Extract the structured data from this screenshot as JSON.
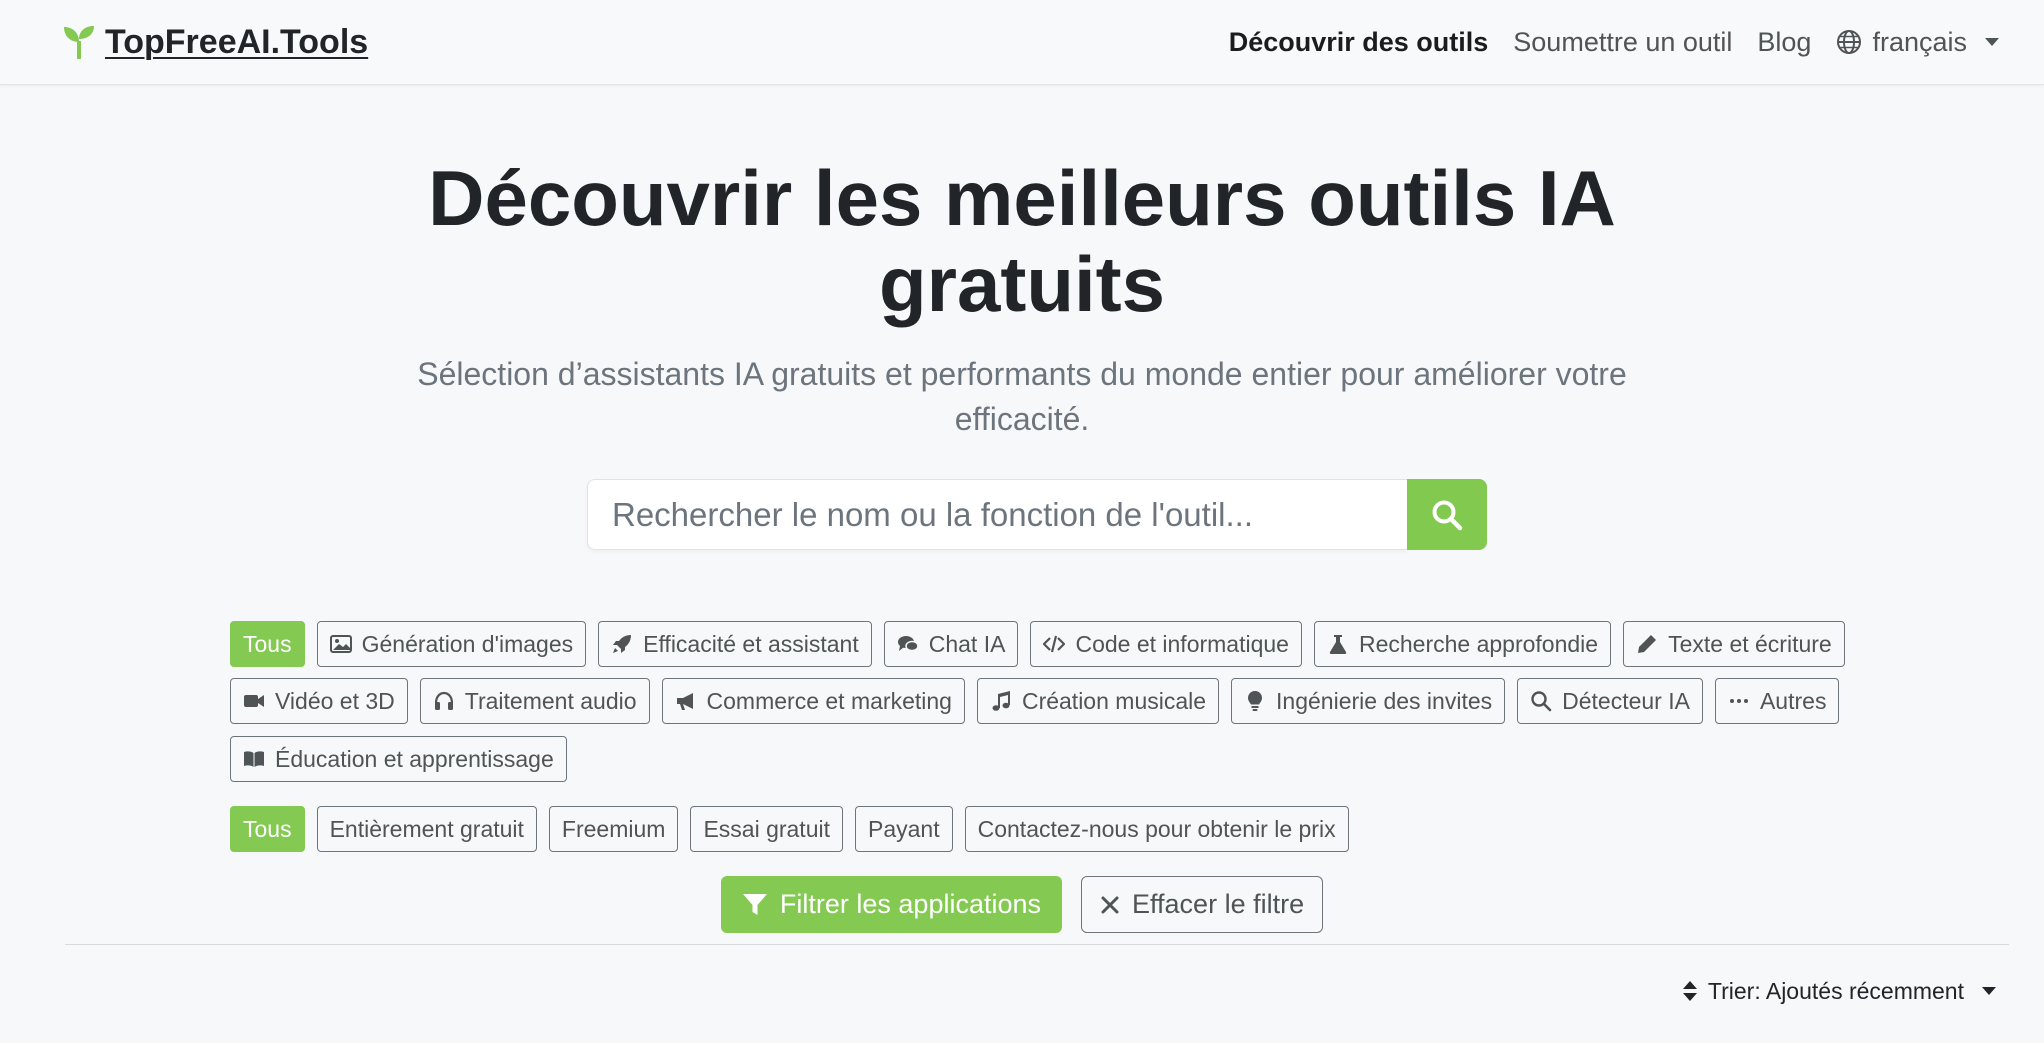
{
  "brand": {
    "name": "TopFreeAI.Tools",
    "accent": "#84c951"
  },
  "nav": {
    "items": [
      {
        "label": "Découvrir des outils",
        "active": true
      },
      {
        "label": "Soumettre un outil",
        "active": false
      },
      {
        "label": "Blog",
        "active": false
      }
    ],
    "language": {
      "label": "français",
      "icon": "globe-icon"
    }
  },
  "hero": {
    "title_line1": "Découvrir les meilleurs outils IA",
    "title_line2": "gratuits",
    "subtitle_line1": "Sélection d’assistants IA gratuits et performants du monde entier pour améliorer votre",
    "subtitle_line2": "efficacité."
  },
  "search": {
    "placeholder": "Rechercher le nom ou la fonction de l'outil...",
    "value": ""
  },
  "categories": [
    {
      "label": "Tous",
      "active": true,
      "icon": ""
    },
    {
      "label": "Génération d'images",
      "icon": "image-icon"
    },
    {
      "label": "Efficacité et assistant",
      "icon": "rocket-icon"
    },
    {
      "label": "Chat IA",
      "icon": "chat-icon"
    },
    {
      "label": "Code et informatique",
      "icon": "code-icon"
    },
    {
      "label": "Recherche approfondie",
      "icon": "flask-icon"
    },
    {
      "label": "Texte et écriture",
      "icon": "pencil-icon"
    },
    {
      "label": "Vidéo et 3D",
      "icon": "video-icon"
    },
    {
      "label": "Traitement audio",
      "icon": "headphones-icon"
    },
    {
      "label": "Commerce et marketing",
      "icon": "megaphone-icon"
    },
    {
      "label": "Création musicale",
      "icon": "music-icon"
    },
    {
      "label": "Ingénierie des invites",
      "icon": "lightbulb-icon"
    },
    {
      "label": "Détecteur IA",
      "icon": "search-icon"
    },
    {
      "label": "Autres",
      "icon": "ellipsis-icon"
    },
    {
      "label": "Éducation et apprentissage",
      "icon": "book-icon"
    }
  ],
  "pricing": [
    {
      "label": "Tous",
      "active": true
    },
    {
      "label": "Entièrement gratuit"
    },
    {
      "label": "Freemium"
    },
    {
      "label": "Essai gratuit"
    },
    {
      "label": "Payant"
    },
    {
      "label": "Contactez-nous pour obtenir le prix"
    }
  ],
  "actions": {
    "filter_label": "Filtrer les applications",
    "clear_label": "Effacer le filtre"
  },
  "sort": {
    "label": "Trier: Ajoutés récemment"
  }
}
